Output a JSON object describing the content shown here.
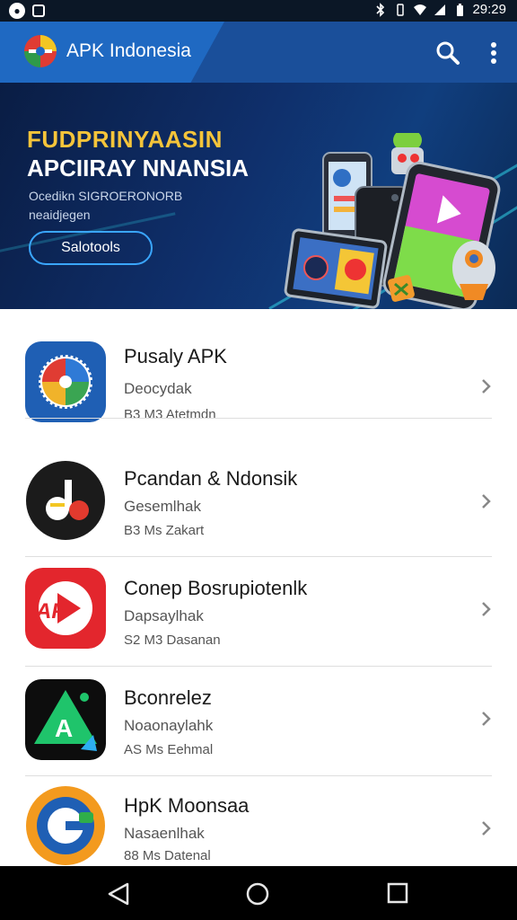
{
  "status_bar": {
    "time": "29:29",
    "left_icons": [
      "notification-icon",
      "lock-icon"
    ],
    "right_icons": [
      "bluetooth-icon",
      "vibrate-icon",
      "wifi-icon",
      "signal-icon",
      "battery-icon"
    ]
  },
  "app_bar": {
    "title": "APK Indonesia",
    "icons": [
      "app-logo-icon",
      "search-icon",
      "more-vert-icon"
    ]
  },
  "banner": {
    "title_line1": "FUDPRINYAASIN",
    "title_line2": "APCIIRAY NNANSIA",
    "subtitle_line1": "Ocedikn SIGROERONORB",
    "subtitle_line2": "neaidjegen",
    "button_label": "Salotools"
  },
  "apps": [
    {
      "name": "Pusaly APK",
      "category": "Deocydak",
      "meta": "B3 M3 Atetmdn",
      "icon": "globe-compass-icon"
    },
    {
      "name": "Pcandan & Ndonsik",
      "category": "Gesemlhak",
      "meta": "B3 Ms Zakart",
      "icon": "music-note-icon"
    },
    {
      "name": "Conep Bosrupiotenlk",
      "category": "Dapsaylhak",
      "meta": "S2 M3 Dasanan",
      "icon": "play-arrow-icon"
    },
    {
      "name": "Bconrelez",
      "category": "Noaonaylahk",
      "meta": "AS Ms Eehmal",
      "icon": "triangle-a-icon"
    },
    {
      "name": "HpK Moonsaa",
      "category": "Nasaenlhak",
      "meta": "88 Ms Datenal",
      "icon": "letter-g-icon"
    }
  ],
  "nav_bar": {
    "icons": [
      "back-icon",
      "home-icon",
      "recents-icon"
    ]
  },
  "colors": {
    "app_bar": "#1a4f9a",
    "banner_accent": "#f5c43a",
    "button_border": "#3aa6ff",
    "icon_blue": "#1f5fb4",
    "icon_red": "#e3262d",
    "icon_dark": "#1b1b1b",
    "icon_green": "#1fc46b",
    "icon_orange": "#f39a1e"
  }
}
